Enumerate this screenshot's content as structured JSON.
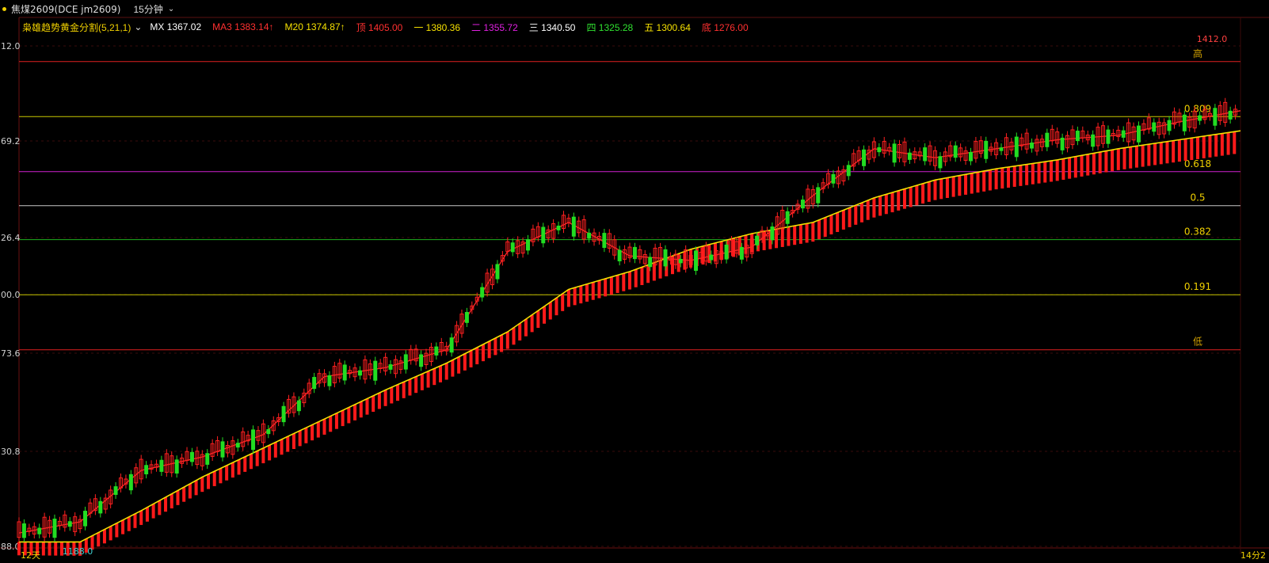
{
  "header": {
    "symbol": "焦煤2609(DCE jm2609)",
    "period": "15分钟",
    "chevron_icon": "chevron-down-icon"
  },
  "legend": {
    "indicator": "枭雄趋势黄金分割(5,21,1)",
    "items": [
      {
        "label": "MX",
        "value": "1367.02",
        "color": "#ffffff"
      },
      {
        "label": "MA3",
        "value": "1383.14↑",
        "color": "#ff3030"
      },
      {
        "label": "M20",
        "value": "1374.87↑",
        "color": "#f5e000"
      },
      {
        "label": "顶",
        "value": "1405.00",
        "color": "#ff3030"
      },
      {
        "label": "一",
        "value": "1380.36",
        "color": "#f5e000"
      },
      {
        "label": "二",
        "value": "1355.72",
        "color": "#e020e0"
      },
      {
        "label": "三",
        "value": "1340.50",
        "color": "#ffffff"
      },
      {
        "label": "四",
        "value": "1325.28",
        "color": "#30e030"
      },
      {
        "label": "五",
        "value": "1300.64",
        "color": "#f5e000"
      },
      {
        "label": "底",
        "value": "1276.00",
        "color": "#ff3030"
      }
    ]
  },
  "y_axis_labels": [
    "12.0",
    "69.2",
    "26.4",
    "00.0",
    "73.6",
    "30.8",
    "88.0"
  ],
  "bottom_labels": {
    "left": "12天",
    "right": "14分2"
  },
  "price_labels": {
    "high": "1412.0",
    "low": "1188.0"
  },
  "chart_data": {
    "type": "line",
    "ylim": [
      1188,
      1412
    ],
    "fib_levels": [
      {
        "label": "高",
        "value": 1405.0,
        "color": "#e02020"
      },
      {
        "label": "0.809",
        "value": 1380.36,
        "color": "#c8c800"
      },
      {
        "label": "0.618",
        "value": 1355.72,
        "color": "#d020d0"
      },
      {
        "label": "0.5",
        "value": 1340.5,
        "color": "#c8c8c8"
      },
      {
        "label": "0.382",
        "value": 1325.28,
        "color": "#20b020"
      },
      {
        "label": "0.191",
        "value": 1300.64,
        "color": "#c8c800"
      },
      {
        "label": "低",
        "value": 1276.0,
        "color": "#e02020"
      }
    ],
    "series": [
      {
        "name": "MA3",
        "color": "#ff2a2a",
        "x": [
          0,
          5,
          10,
          15,
          20,
          25,
          30,
          35,
          40,
          45,
          50,
          55,
          60,
          65,
          70,
          75,
          80,
          85,
          90,
          95,
          100
        ],
        "values": [
          1194,
          1199,
          1222,
          1228,
          1238,
          1264,
          1268,
          1276,
          1320,
          1333,
          1318,
          1316,
          1322,
          1345,
          1366,
          1362,
          1366,
          1370,
          1372,
          1378,
          1383
        ]
      },
      {
        "name": "M20",
        "color": "#f5e000",
        "x": [
          0,
          5,
          10,
          15,
          20,
          25,
          30,
          35,
          40,
          45,
          50,
          55,
          60,
          65,
          70,
          75,
          80,
          85,
          90,
          95,
          100
        ],
        "values": [
          1190,
          1190,
          1204,
          1219,
          1232,
          1245,
          1258,
          1270,
          1284,
          1303,
          1311,
          1321,
          1328,
          1333,
          1344,
          1352,
          1357,
          1361,
          1366,
          1370,
          1374
        ]
      }
    ]
  }
}
